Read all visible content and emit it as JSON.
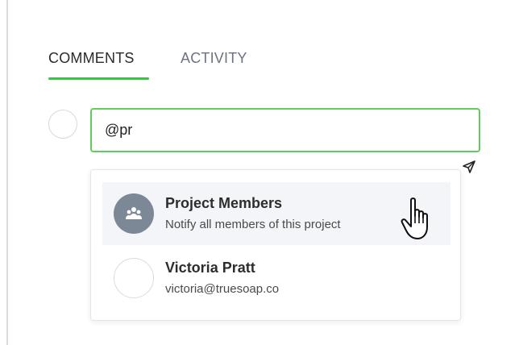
{
  "tabs": {
    "comments": "COMMENTS",
    "activity": "ACTIVITY",
    "active": "comments"
  },
  "comment_box": {
    "value": "@pr"
  },
  "mentions": [
    {
      "name": "Project Members",
      "subtitle": "Notify all members of this project",
      "avatar": "group-icon",
      "highlighted": true
    },
    {
      "name": "Victoria Pratt",
      "subtitle": "victoria@truesoap.co",
      "avatar": "empty-avatar",
      "highlighted": false
    }
  ],
  "icons": {
    "send": "send-icon",
    "cursor": "hand-pointer-cursor"
  },
  "colors": {
    "accent_green": "#3cc449",
    "input_border": "#60cc5a",
    "group_avatar": "#7d8896",
    "highlight_bg": "#f3f5f8"
  }
}
